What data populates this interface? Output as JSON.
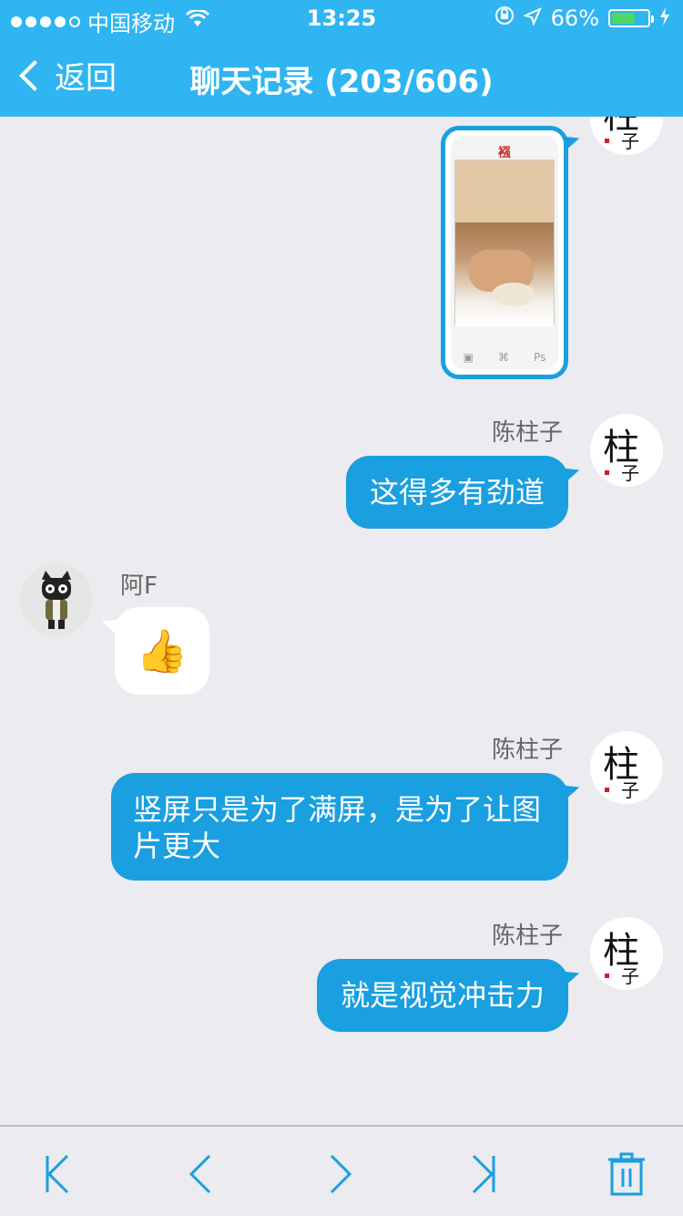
{
  "status_bar": {
    "carrier": "中国移动",
    "time": "13:25",
    "battery_percent": "66%",
    "battery_level": 0.66,
    "signal_bars_filled": 4,
    "signal_bars_total": 5,
    "icons": [
      "wifi-icon",
      "rotation-lock-icon",
      "location-arrow-icon",
      "battery-icon",
      "charging-bolt-icon"
    ]
  },
  "nav": {
    "back_label": "返回",
    "title": "聊天记录 (203/606)"
  },
  "messages": [
    {
      "type": "image",
      "side": "right",
      "sender": "",
      "avatar": "zhuzi-calligraphy-avatar"
    },
    {
      "type": "text",
      "side": "right",
      "sender": "陈柱子",
      "text": "这得多有劲道",
      "avatar": "zhuzi-calligraphy-avatar"
    },
    {
      "type": "emoji",
      "side": "left",
      "sender": "阿F",
      "text": "👍",
      "avatar": "black-cat-avatar"
    },
    {
      "type": "text",
      "side": "right",
      "sender": "陈柱子",
      "text_line1": "竖屏只是为了满屏，是为了让图",
      "text_line2": "片更大",
      "avatar": "zhuzi-calligraphy-avatar"
    },
    {
      "type": "text",
      "side": "right",
      "sender": "陈柱子",
      "text": "就是视觉冲击力",
      "avatar": "zhuzi-calligraphy-avatar"
    }
  ],
  "image_preview": {
    "logo_text": "襁",
    "nav_labels": [
      "▣",
      "⌘",
      "Ps"
    ]
  },
  "bottom_bar": {
    "buttons": [
      "first-page-icon",
      "previous-page-icon",
      "next-page-icon",
      "last-page-icon",
      "trash-icon"
    ]
  },
  "colors": {
    "header": "#2fb5f1",
    "bubble_outgoing": "#1a9fe0",
    "bubble_incoming": "#ffffff",
    "background": "#ebebf0",
    "icon_blue": "#1a9fe0"
  }
}
